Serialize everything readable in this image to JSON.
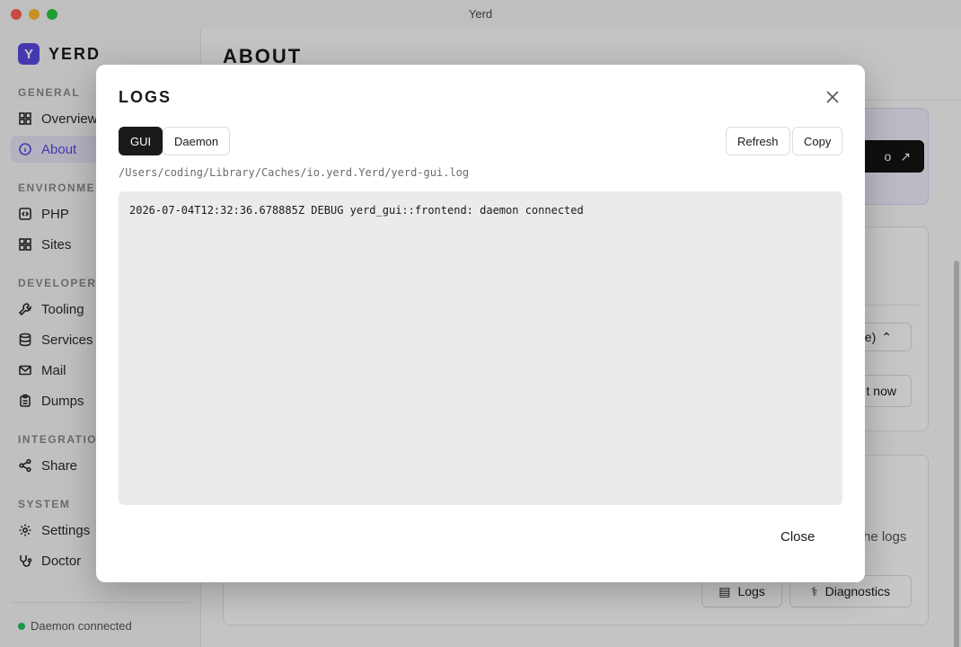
{
  "window": {
    "title": "Yerd"
  },
  "brand": {
    "logo_letter": "Y",
    "name": "YERD",
    "accent_color": "#5a48e0"
  },
  "sidebar": {
    "sections": [
      {
        "title": "General"
      },
      {
        "title": "Environment"
      },
      {
        "title": "Developer"
      },
      {
        "title": "Integrations"
      },
      {
        "title": "System"
      }
    ],
    "items": [
      {
        "label": "Overview",
        "icon": "grid-icon"
      },
      {
        "label": "About",
        "icon": "info-icon",
        "active": true
      },
      {
        "label": "PHP",
        "icon": "code-icon"
      },
      {
        "label": "Sites",
        "icon": "grid-icon"
      },
      {
        "label": "Tooling",
        "icon": "wrench-icon"
      },
      {
        "label": "Services",
        "icon": "database-icon"
      },
      {
        "label": "Mail",
        "icon": "mail-icon"
      },
      {
        "label": "Dumps",
        "icon": "clipboard-icon"
      },
      {
        "label": "Share",
        "icon": "share-icon"
      },
      {
        "label": "Settings",
        "icon": "gear-icon"
      },
      {
        "label": "Doctor",
        "icon": "stethoscope-icon"
      }
    ],
    "status": {
      "text": "Daemon connected",
      "color": "#22c55e"
    }
  },
  "main": {
    "title": "ABOUT",
    "background_fragments": {
      "repo_button_suffix": "o",
      "select_suffix": "ase)",
      "check_button_suffix": "t now",
      "logs_hint_suffix": "he logs",
      "logs_button": "Logs",
      "diagnostics_button": "Diagnostics"
    }
  },
  "modal": {
    "title": "LOGS",
    "tabs": [
      {
        "label": "GUI",
        "active": true
      },
      {
        "label": "Daemon",
        "active": false
      }
    ],
    "refresh_label": "Refresh",
    "copy_label": "Copy",
    "path": "/Users/coding/Library/Caches/io.yerd.Yerd/yerd-gui.log",
    "log_content": "2026-07-04T12:32:36.678885Z DEBUG yerd_gui::frontend: daemon connected",
    "close_label": "Close"
  }
}
